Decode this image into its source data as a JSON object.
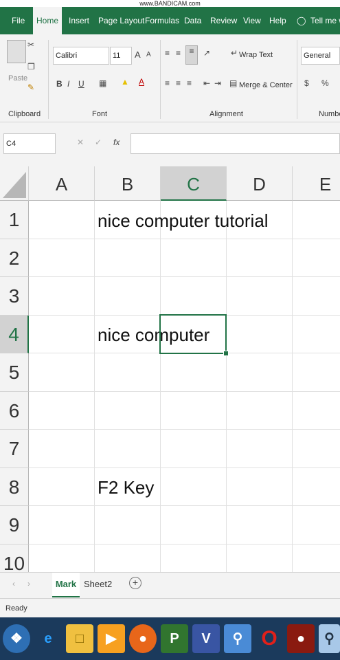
{
  "watermark": "www.BANDICAM.com",
  "tabs": [
    {
      "label": "File"
    },
    {
      "label": "Home",
      "active": true
    },
    {
      "label": "Insert"
    },
    {
      "label": "Page Layout"
    },
    {
      "label": "Formulas"
    },
    {
      "label": "Data"
    },
    {
      "label": "Review"
    },
    {
      "label": "View"
    },
    {
      "label": "Help"
    },
    {
      "label": "Tell me wh"
    }
  ],
  "clipboard": {
    "paste_label": "Paste",
    "group_label": "Clipboard"
  },
  "font": {
    "name": "Calibri",
    "size": "11",
    "group_label": "Font",
    "bold": "B",
    "italic": "I",
    "underline": "U",
    "grow": "A",
    "shrink": "A",
    "color": "A"
  },
  "alignment": {
    "wrap_text": "Wrap Text",
    "merge_center": "Merge & Center",
    "group_label": "Alignment"
  },
  "number": {
    "format": "General",
    "currency": "$",
    "percent": "%",
    "group_label": "Number"
  },
  "formula_bar": {
    "name_box": "C4",
    "cancel": "✕",
    "enter": "✓",
    "fx": "fx",
    "formula": ""
  },
  "columns": [
    "A",
    "B",
    "C",
    "D",
    "E"
  ],
  "selected_column": "C",
  "rows": [
    "1",
    "2",
    "3",
    "4",
    "5",
    "6",
    "7",
    "8",
    "9",
    "10"
  ],
  "selected_row": "4",
  "cells": {
    "B1": "nice computer tutorial",
    "B4": "nice computer",
    "B8": "F2 Key"
  },
  "active_cell": "C4",
  "sheets": [
    {
      "label": "Mark",
      "active": true
    },
    {
      "label": "Sheet2"
    }
  ],
  "add_sheet": "+",
  "status": "Ready",
  "taskbar_icons": [
    "windows-start-icon",
    "internet-explorer-icon",
    "file-explorer-icon",
    "media-player-icon",
    "firefox-icon",
    "project-icon",
    "visio-icon",
    "search-app-icon",
    "opera-icon",
    "app-icon",
    "search-magnifier-icon"
  ],
  "colors": {
    "accent": "#217346",
    "ribbon_bg": "#f3f3f3",
    "taskbar": "#1b3a5c"
  }
}
